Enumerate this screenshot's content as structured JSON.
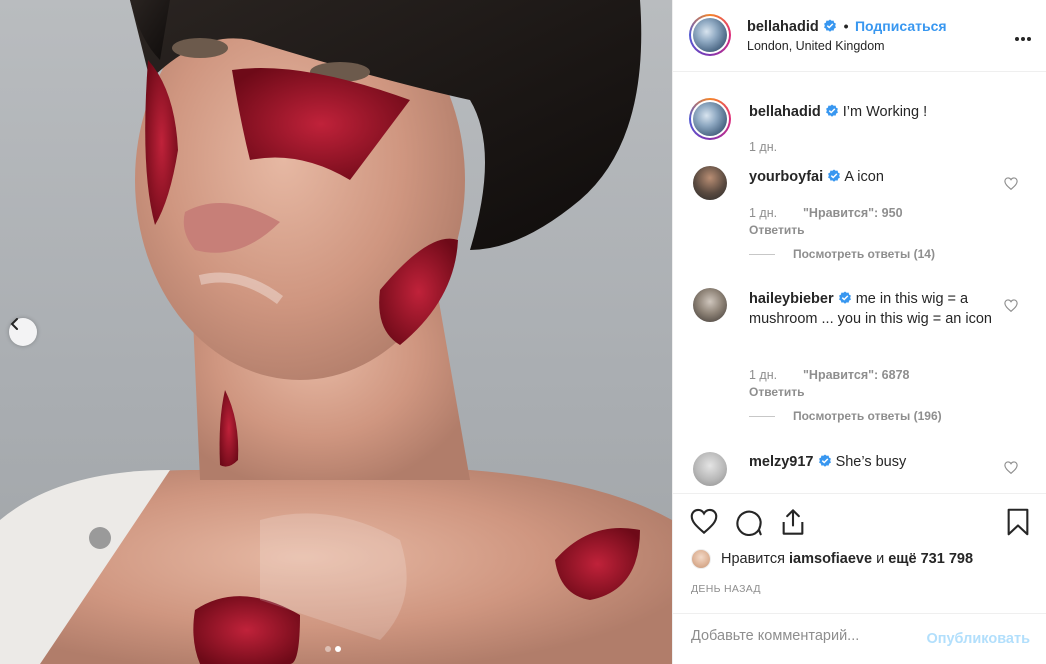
{
  "post": {
    "author": "bellahadid",
    "follow_label": "Подписаться",
    "bullet": "•",
    "location": "London, United Kingdom",
    "more_label": "•••"
  },
  "caption": {
    "username": "bellahadid",
    "text": "I’m Working !",
    "time": "1 дн."
  },
  "comments": [
    {
      "username": "yourboyfai",
      "verified": true,
      "text": "A icon",
      "time": "1 дн.",
      "likes": "\"Нравится\": 950",
      "reply_label": "Ответить",
      "view_replies": "Посмотреть ответы (14)"
    },
    {
      "username": "haileybieber",
      "verified": true,
      "text": "me in this wig = a mushroom ... you in this wig = an icon",
      "time": "1 дн.",
      "likes": "\"Нравится\": 6878",
      "reply_label": "Ответить",
      "view_replies": "Посмотреть ответы (196)"
    },
    {
      "username": "melzy917",
      "verified": true,
      "text": "She’s busy"
    }
  ],
  "likes_bar": {
    "prefix": "Нравится",
    "user": "iamsofiaeve",
    "middle": "и",
    "others": "ещё 731 798"
  },
  "timestamp": "День назад",
  "composer": {
    "placeholder": "Добавьте комментарий...",
    "publish_label": "Опубликовать"
  },
  "carousel": {
    "current_index": 2,
    "total": 2
  },
  "colors": {
    "link_blue": "#3897f0",
    "verified_blue": "#3897f0",
    "publish_disabled": "#b2dffc",
    "secondary_text": "#8e8e8e"
  },
  "icons": [
    "chevron-left-icon",
    "verified-badge-icon",
    "heart-icon",
    "comment-icon",
    "share-icon",
    "bookmark-icon",
    "more-icon"
  ]
}
